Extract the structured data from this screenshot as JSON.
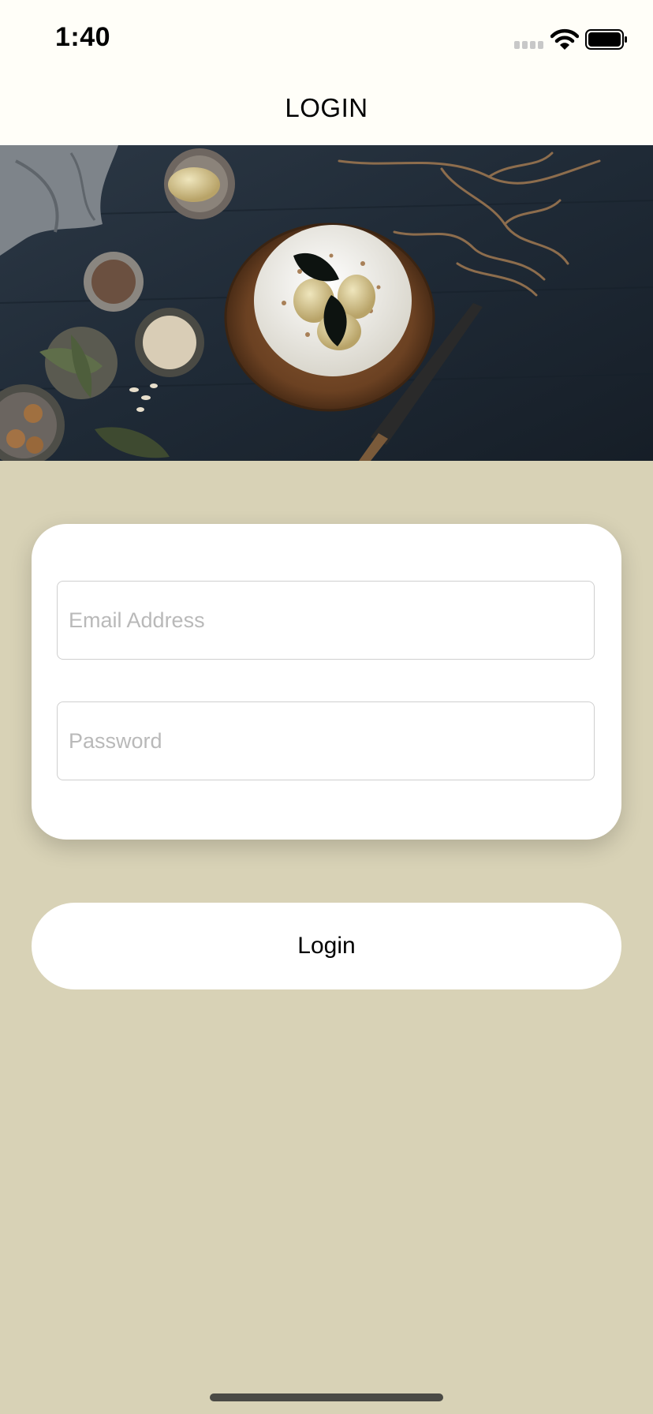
{
  "status_bar": {
    "time": "1:40",
    "icons": [
      "signal-icon",
      "wifi-icon",
      "battery-icon"
    ]
  },
  "nav": {
    "title": "LOGIN"
  },
  "hero": {
    "image": "cake-on-wooden-board-photo"
  },
  "form": {
    "email": {
      "value": "",
      "placeholder": "Email Address"
    },
    "password": {
      "value": "",
      "placeholder": "Password"
    }
  },
  "login_button": {
    "label": "Login"
  },
  "colors": {
    "background": "#d8d2b6",
    "header": "#fffef8",
    "card": "#ffffff"
  }
}
